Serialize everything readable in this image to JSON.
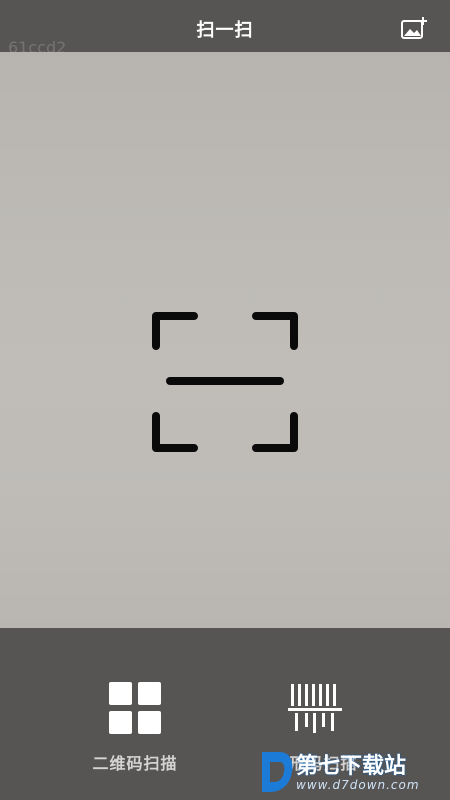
{
  "header": {
    "title": "扫一扫",
    "album_icon": "image-add-icon",
    "watermark": "61ccd2"
  },
  "scanner": {
    "frame_icon": "scan-frame-icon"
  },
  "modes": [
    {
      "label": "二维码扫描",
      "icon": "qr-grid-icon"
    },
    {
      "label": "条形码扫描",
      "icon": "barcode-icon"
    }
  ],
  "overlay_logo": {
    "brand": "第七下载站",
    "url": "www.d7down.com"
  },
  "colors": {
    "bar_bg": "#575553",
    "camera_bg": "#bdbab6",
    "frame": "#0a0a0a",
    "logo_blue": "#1c7bd6"
  }
}
